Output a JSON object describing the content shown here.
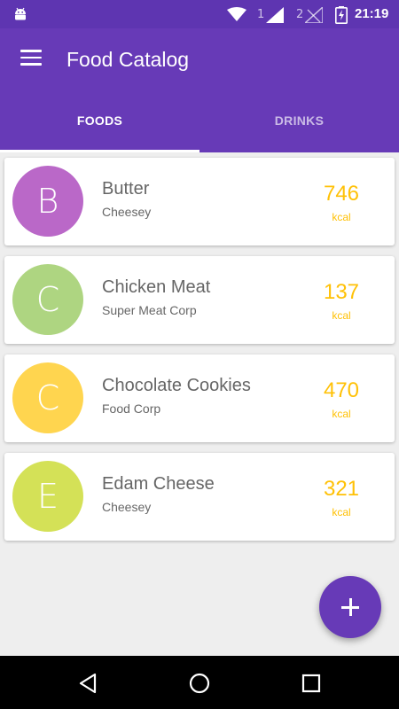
{
  "status_bar": {
    "time": "21:19",
    "sim1": "1",
    "sim2": "2",
    "icons": [
      "android-icon",
      "wifi-icon",
      "signal-icon",
      "battery-charging-icon"
    ]
  },
  "app_bar": {
    "title": "Food Catalog",
    "menu_icon": "menu-icon",
    "background_color": "#673ab7",
    "status_color": "#5e35b1"
  },
  "tabs": [
    {
      "label": "FOODS",
      "active": true
    },
    {
      "label": "DRINKS",
      "active": false
    }
  ],
  "foods": [
    {
      "initial": "B",
      "name": "Butter",
      "producer": "Cheesey",
      "kcal": "746",
      "kcal_unit": "kcal",
      "avatar_color": "#ba68c8"
    },
    {
      "initial": "C",
      "name": "Chicken Meat",
      "producer": "Super Meat Corp",
      "kcal": "137",
      "kcal_unit": "kcal",
      "avatar_color": "#aed581"
    },
    {
      "initial": "C",
      "name": "Chocolate Cookies",
      "producer": "Food Corp",
      "kcal": "470",
      "kcal_unit": "kcal",
      "avatar_color": "#ffd54f"
    },
    {
      "initial": "E",
      "name": "Edam Cheese",
      "producer": "Cheesey",
      "kcal": "321",
      "kcal_unit": "kcal",
      "avatar_color": "#d4e157"
    }
  ],
  "fab": {
    "icon": "plus-icon",
    "color": "#673ab7"
  },
  "nav_bar": {
    "icons": [
      "back-icon",
      "home-icon",
      "recents-icon"
    ]
  },
  "colors": {
    "accent": "#ffc107",
    "background": "#eeeeee"
  }
}
